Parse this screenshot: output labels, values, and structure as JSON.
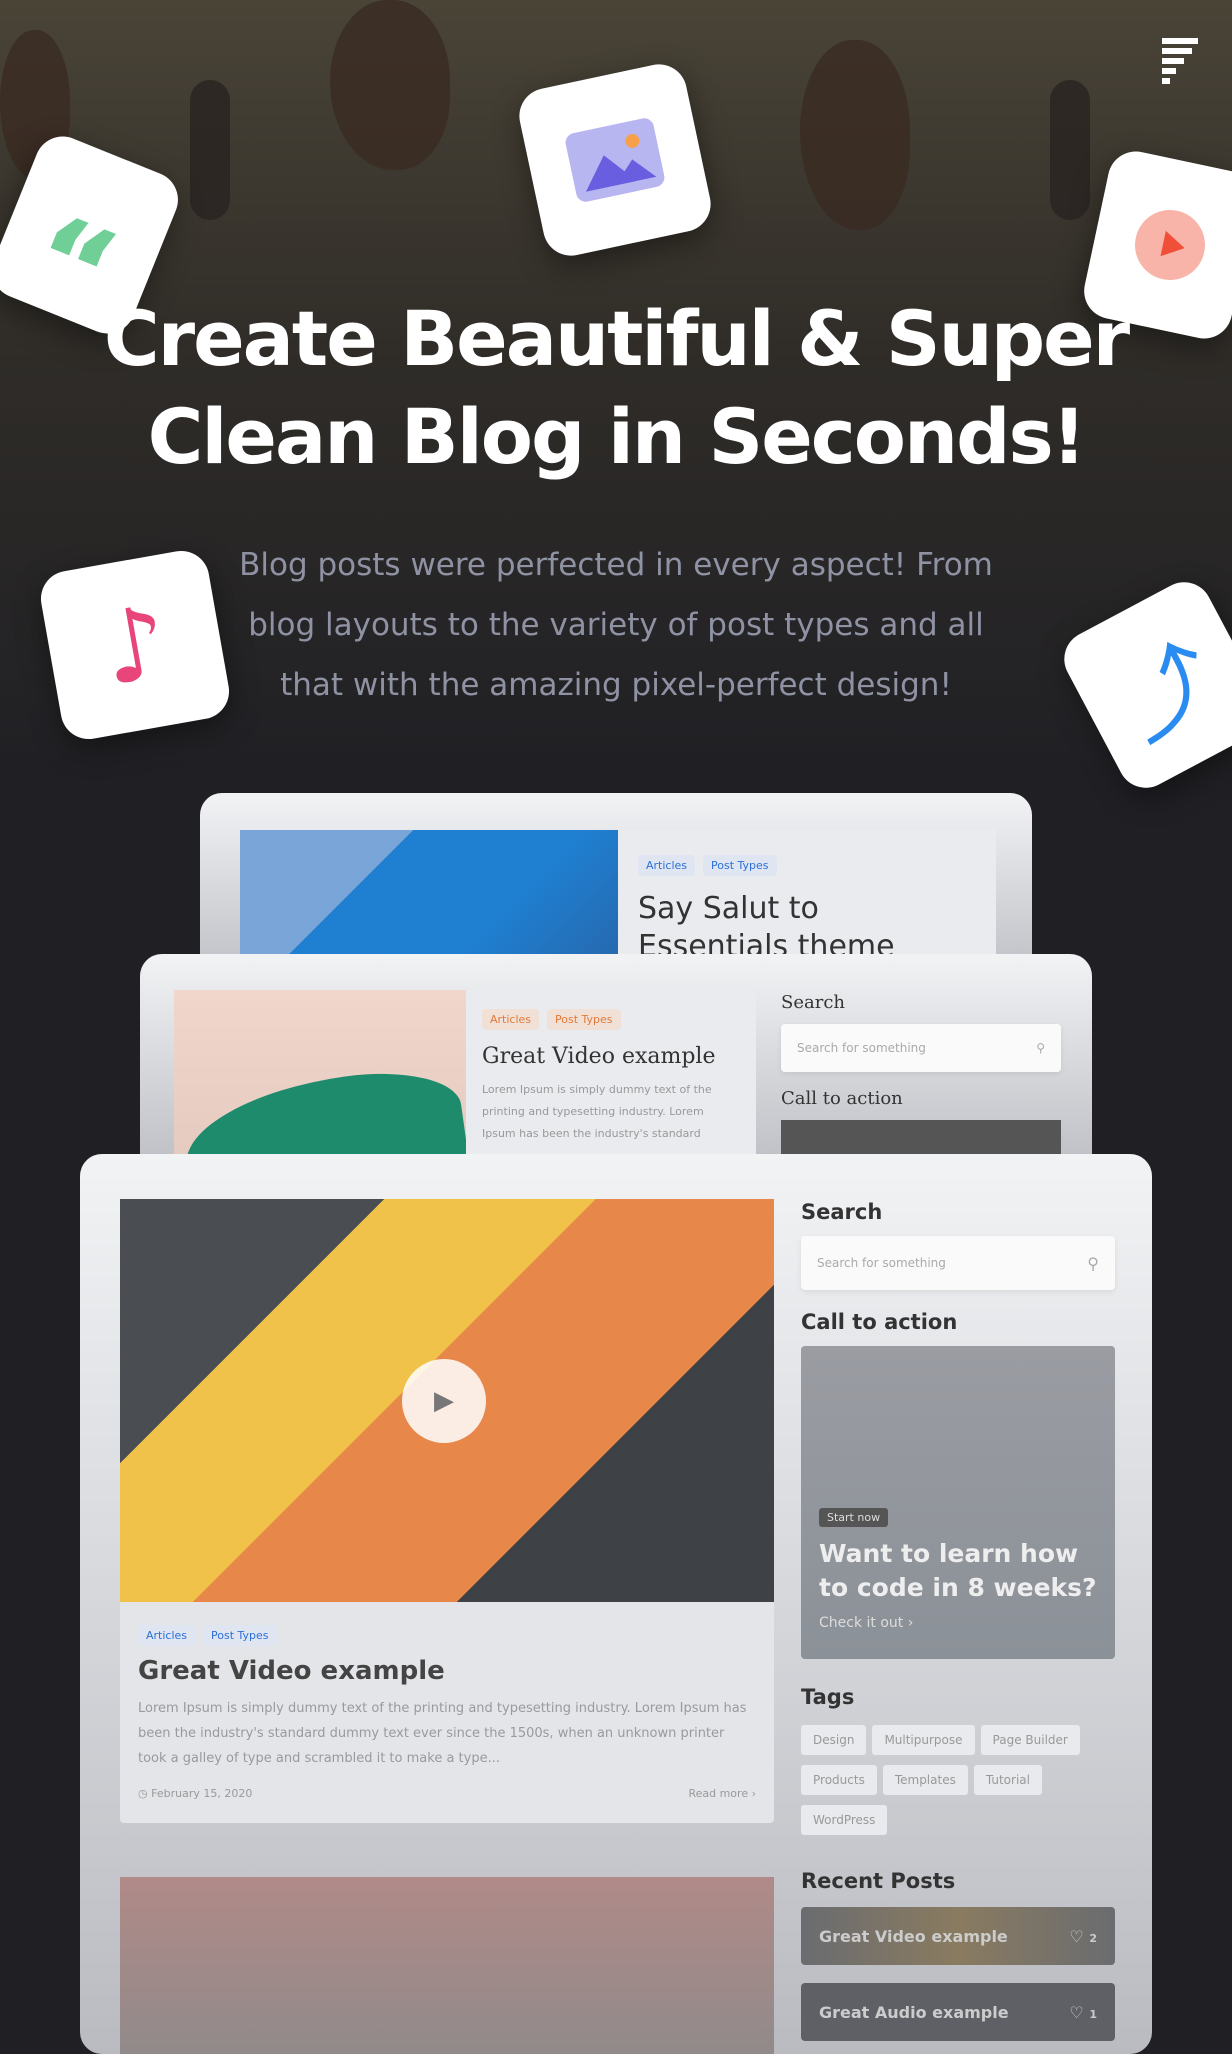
{
  "hero": {
    "title_line1": "Create Beautiful & Super",
    "title_line2": "Clean Blog in Seconds!",
    "subtitle_lines": [
      "Blog posts were perfected in every aspect! From",
      "blog layouts to the variety of post types and all",
      "that with the amazing pixel-perfect design!"
    ]
  },
  "icons": [
    "quote-icon",
    "image-icon",
    "play-icon",
    "music-icon",
    "share-icon"
  ],
  "card1": {
    "chips": [
      "Articles",
      "Post Types"
    ],
    "title": "Say Salut to Essentials theme"
  },
  "card2": {
    "chips": [
      "Articles",
      "Post Types"
    ],
    "title": "Great Video example",
    "excerpt": "Lorem Ipsum is simply dummy text of the printing and typesetting industry. Lorem Ipsum has been the industry's standard",
    "search_label": "Search",
    "search_placeholder": "Search for something",
    "cta_label": "Call to action"
  },
  "card3": {
    "post": {
      "chips": [
        "Articles",
        "Post Types"
      ],
      "title": "Great Video example",
      "excerpt": "Lorem Ipsum is simply dummy text of the printing and typesetting industry. Lorem Ipsum has been the industry's standard dummy text ever since the 1500s, when an unknown printer took a galley of type and scrambled it to make a type...",
      "date": "February 15, 2020",
      "read_more": "Read more"
    },
    "sidebar": {
      "search_label": "Search",
      "search_placeholder": "Search for something",
      "cta_label": "Call to action",
      "cta": {
        "badge": "Start now",
        "heading": "Want to learn how to code in 8 weeks?",
        "link": "Check it out"
      },
      "tags_label": "Tags",
      "tags": [
        "Design",
        "Multipurpose",
        "Page Builder",
        "Products",
        "Templates",
        "Tutorial",
        "WordPress"
      ],
      "recent_label": "Recent Posts",
      "recent": [
        {
          "title": "Great Video example",
          "likes": "2"
        },
        {
          "title": "Great Audio example",
          "likes": "1"
        }
      ]
    }
  },
  "colors": {
    "background": "#1f1f24",
    "accent_blue": "#2c6fd8",
    "accent_orange": "#e07a3a"
  }
}
